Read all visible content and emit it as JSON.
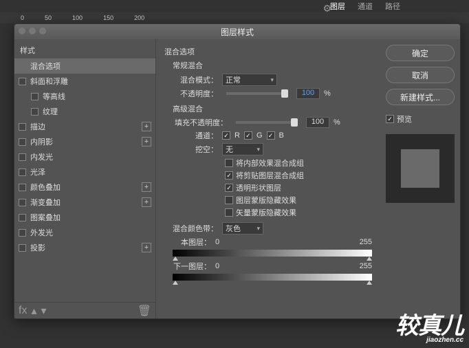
{
  "app": {
    "tabs": [
      "图层",
      "通道",
      "路径"
    ],
    "activeTab": "图层",
    "rulerMarks": [
      "0",
      "50",
      "100",
      "150",
      "200"
    ]
  },
  "dialog": {
    "title": "图层样式",
    "leftHeader": "样式",
    "styles": [
      {
        "label": "混合选项",
        "selected": true,
        "hasCheck": false,
        "hasPlus": false
      },
      {
        "label": "斜面和浮雕",
        "hasCheck": true,
        "hasPlus": false
      },
      {
        "label": "等高线",
        "hasCheck": true,
        "hasPlus": false,
        "indent": true
      },
      {
        "label": "纹理",
        "hasCheck": true,
        "hasPlus": false,
        "indent": true
      },
      {
        "label": "描边",
        "hasCheck": true,
        "hasPlus": true
      },
      {
        "label": "内阴影",
        "hasCheck": true,
        "hasPlus": true
      },
      {
        "label": "内发光",
        "hasCheck": true,
        "hasPlus": false
      },
      {
        "label": "光泽",
        "hasCheck": true,
        "hasPlus": false
      },
      {
        "label": "颜色叠加",
        "hasCheck": true,
        "hasPlus": true
      },
      {
        "label": "渐变叠加",
        "hasCheck": true,
        "hasPlus": true
      },
      {
        "label": "图案叠加",
        "hasCheck": true,
        "hasPlus": false
      },
      {
        "label": "外发光",
        "hasCheck": true,
        "hasPlus": false
      },
      {
        "label": "投影",
        "hasCheck": true,
        "hasPlus": true
      }
    ],
    "blending": {
      "sectionTitle": "混合选项",
      "general": {
        "title": "常规混合",
        "modeLabel": "混合模式：",
        "modeValue": "正常",
        "opacityLabel": "不透明度：",
        "opacityValue": "100",
        "percent": "%"
      },
      "advanced": {
        "title": "高级混合",
        "fillLabel": "填充不透明度：",
        "fillValue": "100",
        "percent": "%",
        "channelsLabel": "通道：",
        "r": "R",
        "g": "G",
        "b": "B",
        "knockoutLabel": "挖空：",
        "knockoutValue": "无",
        "opts": [
          {
            "label": "将内部效果混合成组",
            "on": false
          },
          {
            "label": "将剪贴图层混合成组",
            "on": true
          },
          {
            "label": "透明形状图层",
            "on": true
          },
          {
            "label": "图层蒙版隐藏效果",
            "on": false
          },
          {
            "label": "矢量蒙版隐藏效果",
            "on": false
          }
        ]
      },
      "blendIf": {
        "title": "混合颜色带：",
        "value": "灰色",
        "thisLabel": "本图层：",
        "thisLow": "0",
        "thisHigh": "255",
        "underLabel": "下一图层：",
        "underLow": "0",
        "underHigh": "255"
      }
    },
    "buttons": {
      "ok": "确定",
      "cancel": "取消",
      "newStyle": "新建样式...",
      "preview": "预览"
    }
  },
  "watermark": {
    "main": "较真儿",
    "sub": "jiaozhen.cc"
  }
}
